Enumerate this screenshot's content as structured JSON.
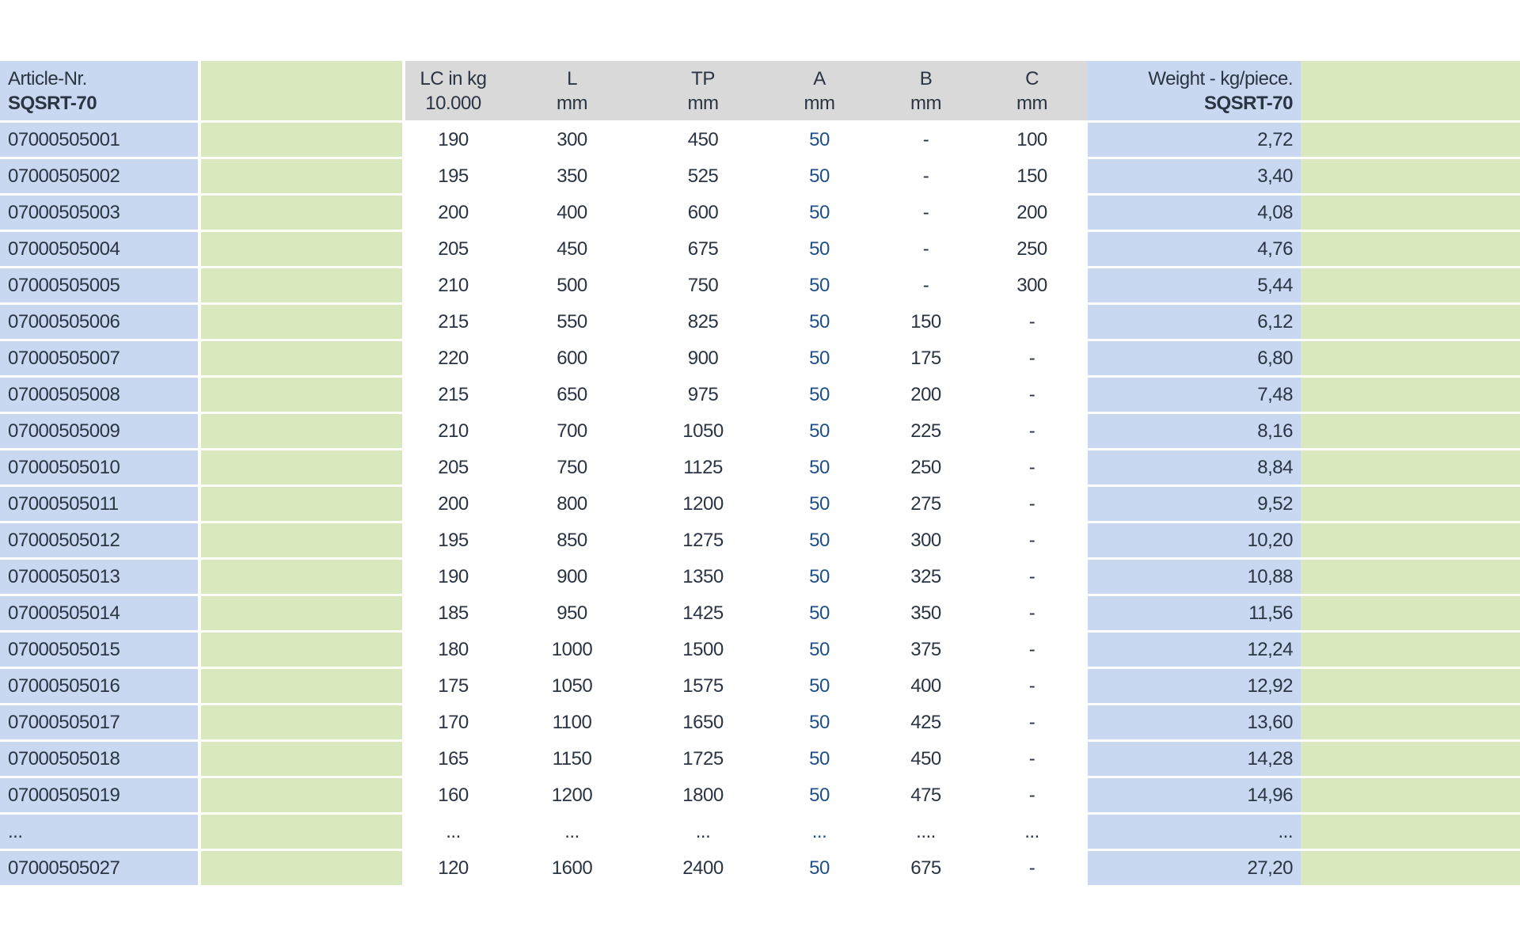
{
  "header": {
    "article_label": "Article-Nr.",
    "article_code": "SQSRT-70",
    "lc_label": "LC in kg",
    "lc_sub": "10.000",
    "l_label": "L",
    "l_unit": "mm",
    "tp_label": "TP",
    "tp_unit": "mm",
    "a_label": "A",
    "a_unit": "mm",
    "b_label": "B",
    "b_unit": "mm",
    "c_label": "C",
    "c_unit": "mm",
    "weight_label": "Weight - kg/piece.",
    "weight_code": "SQSRT-70"
  },
  "rows": [
    {
      "article": "07000505001",
      "lc": "190",
      "l": "300",
      "tp": "450",
      "a": "50",
      "b": "-",
      "c": "100",
      "weight": "2,72"
    },
    {
      "article": "07000505002",
      "lc": "195",
      "l": "350",
      "tp": "525",
      "a": "50",
      "b": "-",
      "c": "150",
      "weight": "3,40"
    },
    {
      "article": "07000505003",
      "lc": "200",
      "l": "400",
      "tp": "600",
      "a": "50",
      "b": "-",
      "c": "200",
      "weight": "4,08"
    },
    {
      "article": "07000505004",
      "lc": "205",
      "l": "450",
      "tp": "675",
      "a": "50",
      "b": "-",
      "c": "250",
      "weight": "4,76"
    },
    {
      "article": "07000505005",
      "lc": "210",
      "l": "500",
      "tp": "750",
      "a": "50",
      "b": "-",
      "c": "300",
      "weight": "5,44"
    },
    {
      "article": "07000505006",
      "lc": "215",
      "l": "550",
      "tp": "825",
      "a": "50",
      "b": "150",
      "c": "-",
      "weight": "6,12"
    },
    {
      "article": "07000505007",
      "lc": "220",
      "l": "600",
      "tp": "900",
      "a": "50",
      "b": "175",
      "c": "-",
      "weight": "6,80"
    },
    {
      "article": "07000505008",
      "lc": "215",
      "l": "650",
      "tp": "975",
      "a": "50",
      "b": "200",
      "c": "-",
      "weight": "7,48"
    },
    {
      "article": "07000505009",
      "lc": "210",
      "l": "700",
      "tp": "1050",
      "a": "50",
      "b": "225",
      "c": "-",
      "weight": "8,16"
    },
    {
      "article": "07000505010",
      "lc": "205",
      "l": "750",
      "tp": "1125",
      "a": "50",
      "b": "250",
      "c": "-",
      "weight": "8,84"
    },
    {
      "article": "07000505011",
      "lc": "200",
      "l": "800",
      "tp": "1200",
      "a": "50",
      "b": "275",
      "c": "-",
      "weight": "9,52"
    },
    {
      "article": "07000505012",
      "lc": "195",
      "l": "850",
      "tp": "1275",
      "a": "50",
      "b": "300",
      "c": "-",
      "weight": "10,20"
    },
    {
      "article": "07000505013",
      "lc": "190",
      "l": "900",
      "tp": "1350",
      "a": "50",
      "b": "325",
      "c": "-",
      "weight": "10,88"
    },
    {
      "article": "07000505014",
      "lc": "185",
      "l": "950",
      "tp": "1425",
      "a": "50",
      "b": "350",
      "c": "-",
      "weight": "11,56"
    },
    {
      "article": "07000505015",
      "lc": "180",
      "l": "1000",
      "tp": "1500",
      "a": "50",
      "b": "375",
      "c": "-",
      "weight": "12,24"
    },
    {
      "article": "07000505016",
      "lc": "175",
      "l": "1050",
      "tp": "1575",
      "a": "50",
      "b": "400",
      "c": "-",
      "weight": "12,92"
    },
    {
      "article": "07000505017",
      "lc": "170",
      "l": "1100",
      "tp": "1650",
      "a": "50",
      "b": "425",
      "c": "-",
      "weight": "13,60"
    },
    {
      "article": "07000505018",
      "lc": "165",
      "l": "1150",
      "tp": "1725",
      "a": "50",
      "b": "450",
      "c": "-",
      "weight": "14,28"
    },
    {
      "article": "07000505019",
      "lc": "160",
      "l": "1200",
      "tp": "1800",
      "a": "50",
      "b": "475",
      "c": "-",
      "weight": "14,96"
    },
    {
      "article": "...",
      "lc": "...",
      "l": "...",
      "tp": "...",
      "a": "...",
      "b": "....",
      "c": "...",
      "weight": "..."
    },
    {
      "article": "07000505027",
      "lc": "120",
      "l": "1600",
      "tp": "2400",
      "a": "50",
      "b": "675",
      "c": "-",
      "weight": "27,20"
    }
  ],
  "colors": {
    "article_column": "#c9d7f0",
    "green_column": "#d9e8bd",
    "header_grey": "#d9d9d9",
    "a_value_blue": "#1f4f8a"
  }
}
